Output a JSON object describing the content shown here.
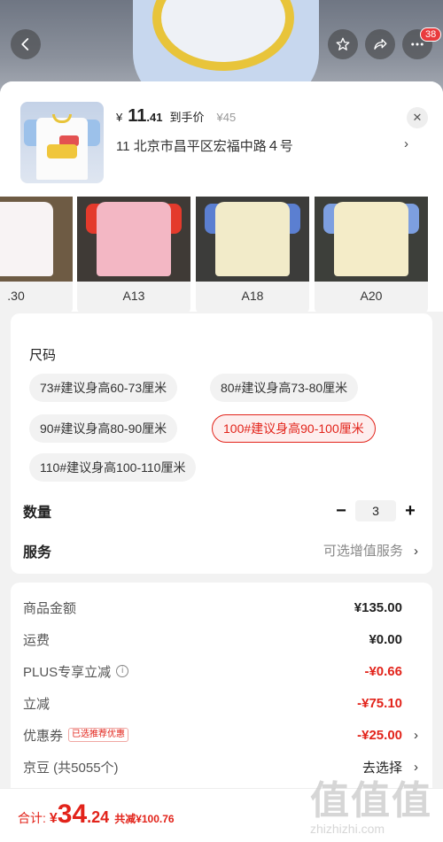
{
  "nav": {
    "back_icon": "chevron-left-icon",
    "favorite_icon": "star-icon",
    "share_icon": "share-icon",
    "more_icon": "more-dots-icon",
    "badge_count": "38"
  },
  "product": {
    "currency": "¥",
    "price_int": "11",
    "price_dec": ".41",
    "price_tag": "到手价",
    "original_price": "¥45",
    "address": "11  北京市昌平区宏福中路４号",
    "address_chevron": "›"
  },
  "variants": [
    {
      "label": ".30"
    },
    {
      "label": "A13"
    },
    {
      "label": "A18"
    },
    {
      "label": "A20"
    }
  ],
  "size": {
    "title": "尺码",
    "options": [
      {
        "label": "73#建议身高60-73厘米",
        "selected": false
      },
      {
        "label": "80#建议身高73-80厘米",
        "selected": false
      },
      {
        "label": "90#建议身高80-90厘米",
        "selected": false
      },
      {
        "label": "100#建议身高90-100厘米",
        "selected": true
      },
      {
        "label": "110#建议身高100-110厘米",
        "selected": false
      }
    ]
  },
  "quantity": {
    "label": "数量",
    "minus": "−",
    "value": "3",
    "plus": "+"
  },
  "service": {
    "label": "服务",
    "value": "可选增值服务",
    "chevron": "›"
  },
  "summary": {
    "goods_label": "商品金额",
    "goods_value": "¥135.00",
    "shipping_label": "运费",
    "shipping_value": "¥0.00",
    "plus_label": "PLUS专享立减",
    "plus_info": "i",
    "plus_value": "-¥0.66",
    "instant_label": "立减",
    "instant_value": "-¥75.10",
    "coupon_label": "优惠券",
    "coupon_tag": "已选推荐优惠",
    "coupon_value": "-¥25.00",
    "beans_label": "京豆 (共5055个)",
    "beans_value": "去选择",
    "chevron": "›"
  },
  "footer": {
    "total_label": "合计:",
    "currency": "¥",
    "total_int": "34",
    "total_dec": ".24",
    "discount": "共减¥100.76"
  },
  "watermark": {
    "glyphs": "值值值",
    "url": "zhizhizhi.com"
  },
  "colors": {
    "accent_red": "#e2231a",
    "collar_yellow": "#e8c43a"
  }
}
